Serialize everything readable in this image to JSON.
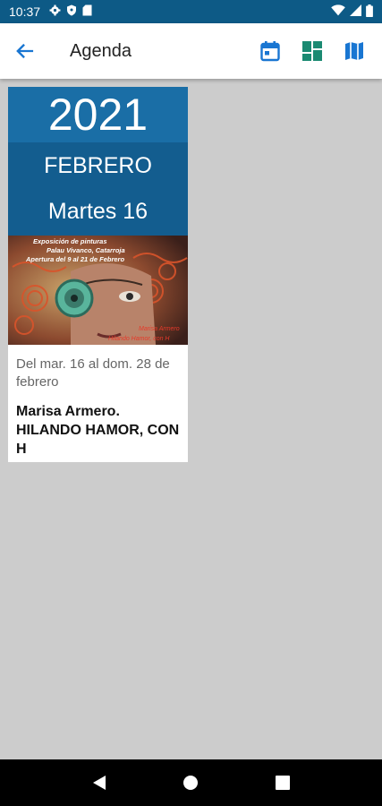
{
  "status_bar": {
    "time": "10:37",
    "icons": [
      "settings-icon",
      "shield-icon",
      "sd-card-icon",
      "wifi-icon",
      "signal-icon",
      "battery-icon"
    ]
  },
  "app_bar": {
    "title": "Agenda",
    "accent_color": "#1976d2",
    "actions": [
      "calendar-icon",
      "grid-view-icon",
      "map-icon"
    ]
  },
  "event_card": {
    "year": "2021",
    "month": "FEBRERO",
    "day": "Martes 16",
    "poster": {
      "line1": "Exposición de pinturas",
      "line2": "Palau Vivanco, Catarroja",
      "line3": "Apertura del 9 al 21 de Febrero",
      "artist": "Marisa Armero",
      "work": "Hilando Hamor, con H"
    },
    "dates": "Del mar. 16 al dom. 28 de febrero",
    "title": "Marisa Armero. HILANDO HAMOR, CON H"
  },
  "colors": {
    "status_bar": "#0d5a86",
    "date_header": "#1a6ea6",
    "background": "#cccccc"
  }
}
